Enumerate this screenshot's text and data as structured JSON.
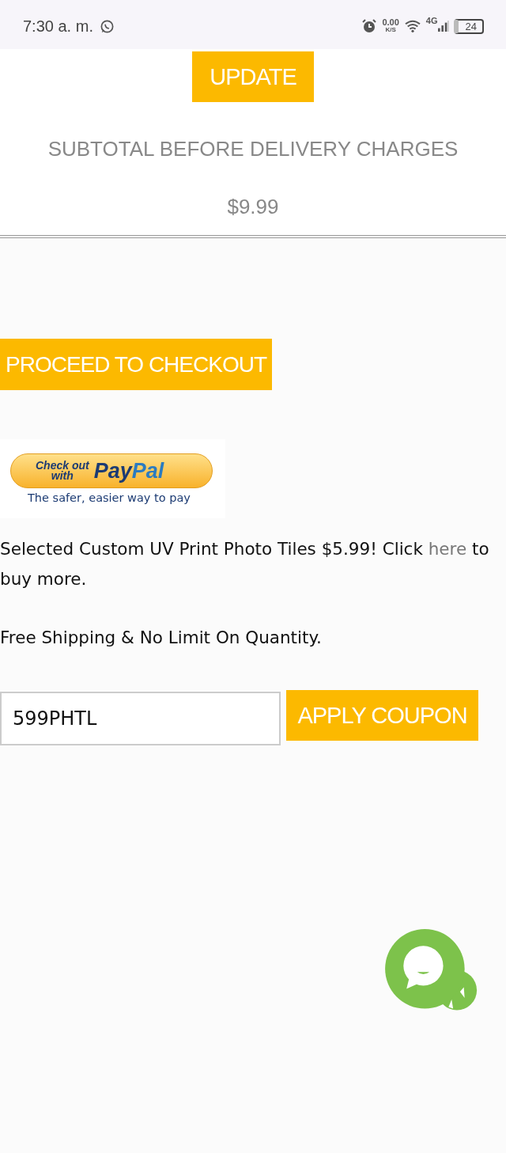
{
  "status_bar": {
    "time": "7:30 a. m.",
    "speed": "0.00",
    "speed_unit": "K/S",
    "network": "4G",
    "battery": "24"
  },
  "update_button": "UPDATE",
  "subtotal": {
    "label": "SUBTOTAL BEFORE DELIVERY CHARGES",
    "value": "$9.99"
  },
  "checkout_button": "PROCEED TO CHECKOUT",
  "paypal": {
    "prefix_top": "Check out",
    "prefix_bottom": "with",
    "brand_dark": "Pay",
    "brand_light": "Pal",
    "tagline": "The safer, easier way to pay"
  },
  "promo": {
    "text": "Selected Custom UV Print Photo Tiles $5.99! Click",
    "link": "here",
    "after": "to buy more."
  },
  "shipping_note": "Free Shipping & No Limit On Quantity.",
  "coupon": {
    "value": "599PHTL",
    "button": "APPLY COUPON"
  }
}
